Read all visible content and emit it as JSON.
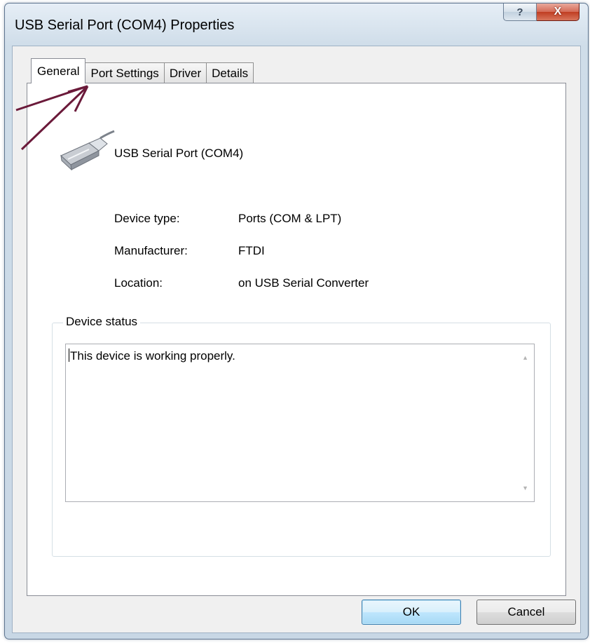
{
  "window": {
    "title": "USB Serial Port (COM4) Properties",
    "help_glyph": "?",
    "close_glyph": "X"
  },
  "tabs": [
    {
      "label": "General",
      "active": true
    },
    {
      "label": "Port Settings",
      "active": false
    },
    {
      "label": "Driver",
      "active": false
    },
    {
      "label": "Details",
      "active": false
    }
  ],
  "general": {
    "device_name": "USB Serial Port (COM4)",
    "properties": [
      {
        "label": "Device type:",
        "value": "Ports (COM & LPT)"
      },
      {
        "label": "Manufacturer:",
        "value": "FTDI"
      },
      {
        "label": "Location:",
        "value": "on USB Serial Converter"
      }
    ],
    "device_status": {
      "legend": "Device status",
      "text": "This device is working properly."
    }
  },
  "buttons": {
    "ok": "OK",
    "cancel": "Cancel"
  },
  "colors": {
    "annotation_arrow": "#6b1a3a",
    "default_button_border": "#3c7fb1",
    "close_button": "#c03d22"
  }
}
